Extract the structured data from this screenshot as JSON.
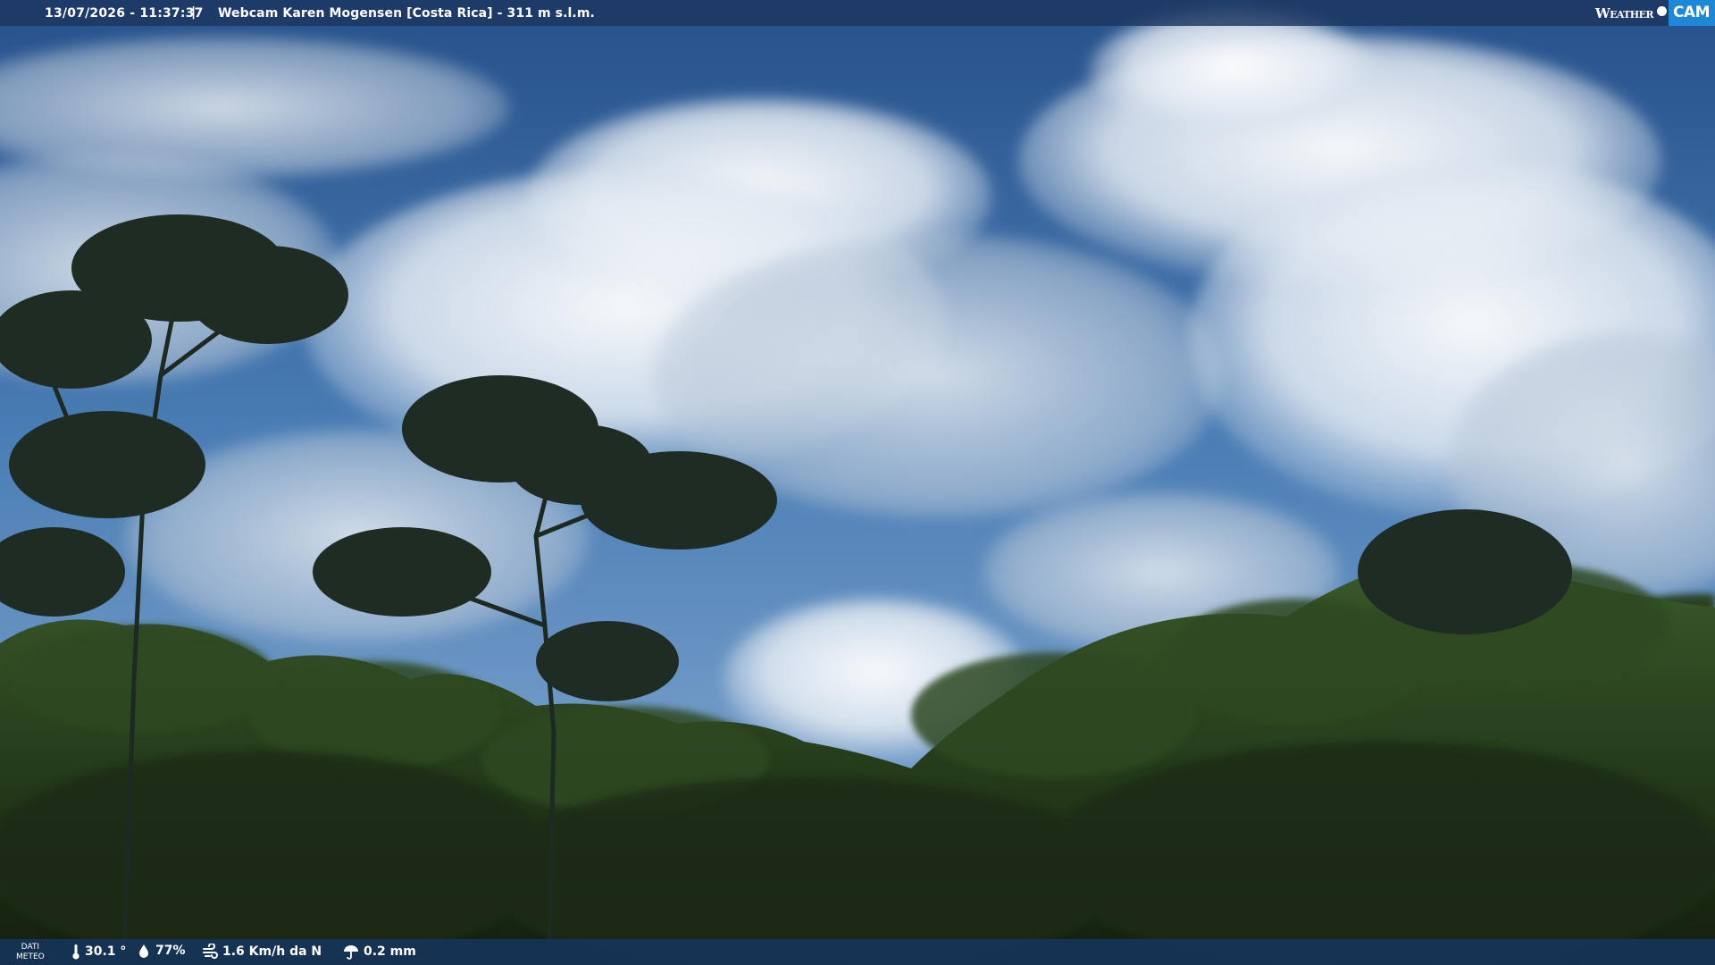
{
  "header": {
    "timestamp": "13/07/2026 - 11:37:37",
    "separator": "|",
    "camera_title": "Webcam Karen Mogensen [Costa Rica]  - 311 m s.l.m."
  },
  "logo": {
    "part1": "Weather",
    "part2": "CAM"
  },
  "footer": {
    "dati_line1": "DATI",
    "dati_line2": "METEO",
    "temperature": "30.1 °",
    "humidity": "77%",
    "wind": "1.6 Km/h da N",
    "rain": "0.2 mm"
  },
  "icons": {
    "temperature": "thermometer-icon",
    "humidity": "droplet-icon",
    "wind": "wind-icon",
    "rain": "umbrella-icon"
  },
  "colors": {
    "sky_top": "#2a5289",
    "sky_mid": "#4f7fb6",
    "cloud": "#e9eef5",
    "forest_dark": "#1b2b15",
    "forest_mid": "#2c4420",
    "bar": "#1c3660",
    "logo_accent": "#1e87d6"
  }
}
